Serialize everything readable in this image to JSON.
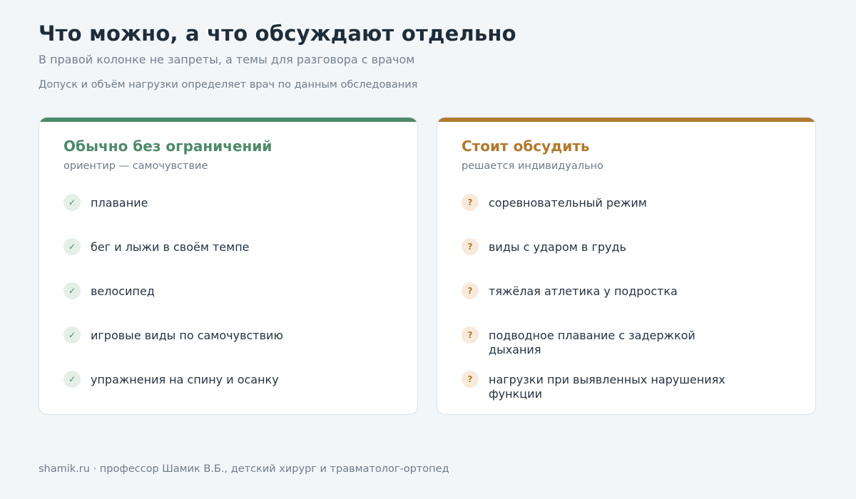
{
  "header": {
    "title": "Что можно, а что обсуждают отдельно",
    "subtitle": "В правой колонке не запреты, а темы для разговора с врачом",
    "note": "Допуск и объём нагрузки определяет врач по данным обследования"
  },
  "colors": {
    "allowed_accent": "#4d8a6a",
    "discuss_accent": "#b07a2e"
  },
  "allowed": {
    "title": "Обычно без ограничений",
    "hint": "ориентир — самочувствие",
    "icon": "check-icon",
    "badge_glyph": "✓",
    "items": [
      "плавание",
      "бег и лыжи в своём темпе",
      "велосипед",
      "игровые виды по самочувствию",
      "упражнения на спину и осанку"
    ]
  },
  "discuss": {
    "title": "Стоит обсудить",
    "hint": "решается индивидуально",
    "icon": "question-icon",
    "badge_glyph": "?",
    "items": [
      "соревновательный режим",
      "виды с ударом в грудь",
      "тяжёлая атлетика у подростка",
      "подводное плавание с задержкой дыхания",
      "нагрузки при выявленных нарушениях функции"
    ]
  },
  "footer": {
    "text": "shamik.ru · профессор Шамик В.Б., детский хирург и травматолог-ортопед"
  }
}
